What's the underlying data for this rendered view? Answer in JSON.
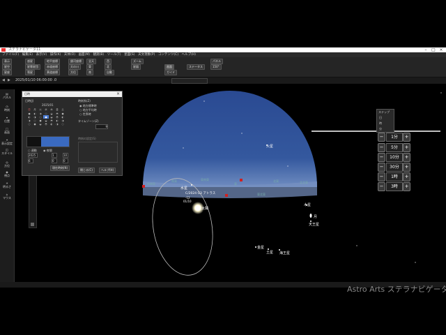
{
  "window": {
    "title": "ステラナビゲータ11"
  },
  "menu": [
    "ファイル(F)",
    "編集(E)",
    "表示(V)",
    "操作(K)",
    "天体(O)",
    "画面(M)",
    "観測(B)",
    "ツール(T)",
    "星図(S)",
    "天文現象(P)",
    "コンテンツ(C)",
    "ヘルプ(H)"
  ],
  "ribbon": {
    "buttons": [
      "表示",
      "星空",
      "星座",
      "惑星",
      "星雲星団",
      "彗星",
      "地平座標",
      "赤道座標",
      "黄道座標",
      "銀河座標",
      "天の川",
      "方位",
      "全天",
      "東",
      "南",
      "西",
      "北",
      "自動",
      "ズーム",
      "星図",
      "画面",
      "ガイド"
    ],
    "status_label": "ステータス",
    "view_select": "パネル",
    "fov_select": "150°"
  },
  "timebar": {
    "datetime": "2025/01/10 06:00:00 .0"
  },
  "left_tools": [
    "パネル",
    "時刻",
    "位置",
    "画面",
    "表示設定",
    "スタイル",
    "方位",
    "視点",
    "明るさ",
    "マウス"
  ],
  "dialog": {
    "title": "日時",
    "date_label": "日時(J)",
    "year_month": "2025/01",
    "weekdays": [
      "日",
      "月",
      "火",
      "水",
      "木",
      "金",
      "土"
    ],
    "time_system_label": "時刻系(Z)",
    "time_opts": [
      "地方標準時",
      "地方平均時",
      "世界時"
    ],
    "timezone_label": "タイムゾーン(Z)",
    "timezone_value": "9",
    "realtime_label": "連動",
    "night_label": "夜間",
    "start_label": "時刻の設定(S)",
    "year": "2025",
    "month": "1",
    "day": "10",
    "hour": "6",
    "minute": "0",
    "second": "0",
    "now_button": "現在時刻(N)",
    "ok_button": "閉じる(C)",
    "help_button": "ヘルプ(H)"
  },
  "small_panel": {
    "title": "ステップ",
    "labels": [
      "日",
      "時",
      "分"
    ]
  },
  "stepper": [
    {
      "value": "1分"
    },
    {
      "value": "5分"
    },
    {
      "value": "10分"
    },
    {
      "value": "30分"
    },
    {
      "value": "1時"
    },
    {
      "value": "3時"
    }
  ],
  "sky": {
    "labels": {
      "mars": "火星",
      "mercury": "水星",
      "comet": "C/2024 G3 アトラス",
      "comet_mag": "-12",
      "comet_date": "01/10",
      "sun": "太陽",
      "jupiter": "木星",
      "moon": "月",
      "uranus": "天王星",
      "venus": "金星",
      "saturn": "土星",
      "neptune": "海王星"
    },
    "horizon": [
      "南南東",
      "南東",
      "東南東",
      "東",
      "東北東",
      "北東",
      "北北東",
      "北"
    ],
    "colors": {
      "dome": "#2c4a8a",
      "horizon": "#6f86b8",
      "marker": "#d02020"
    }
  },
  "watermark": "Astro Arts ステラナビゲータ11"
}
